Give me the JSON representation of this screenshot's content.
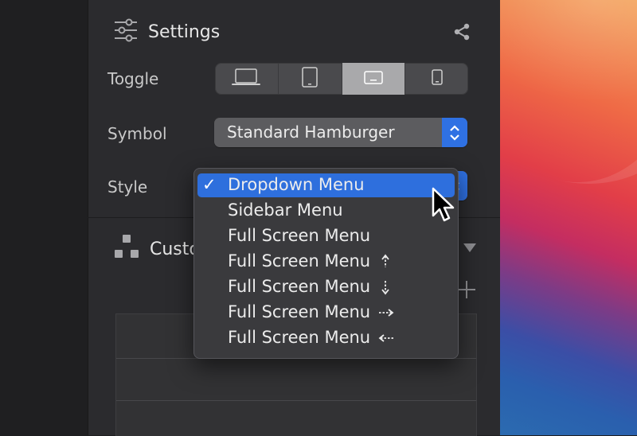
{
  "settings": {
    "title": "Settings",
    "toggle_label": "Toggle",
    "toggle_options": [
      {
        "icon": "laptop-icon"
      },
      {
        "icon": "tablet-icon"
      },
      {
        "icon": "tablet-landscape-icon",
        "selected": true
      },
      {
        "icon": "phone-icon"
      }
    ],
    "symbol_label": "Symbol",
    "symbol_value": "Standard Hamburger",
    "style_label": "Style"
  },
  "style_menu": {
    "items": [
      {
        "label": "Dropdown Menu",
        "checked": true,
        "arrow": ""
      },
      {
        "label": "Sidebar Menu",
        "arrow": ""
      },
      {
        "label": "Full Screen Menu",
        "arrow": ""
      },
      {
        "label": "Full Screen Menu",
        "arrow": "up"
      },
      {
        "label": "Full Screen Menu",
        "arrow": "down"
      },
      {
        "label": "Full Screen Menu",
        "arrow": "right"
      },
      {
        "label": "Full Screen Menu",
        "arrow": "left"
      }
    ],
    "check_mark": "✓"
  },
  "custom_section": {
    "title": "Custo"
  },
  "colors": {
    "accent": "#2f71e3",
    "panel": "#2b2b2e"
  }
}
